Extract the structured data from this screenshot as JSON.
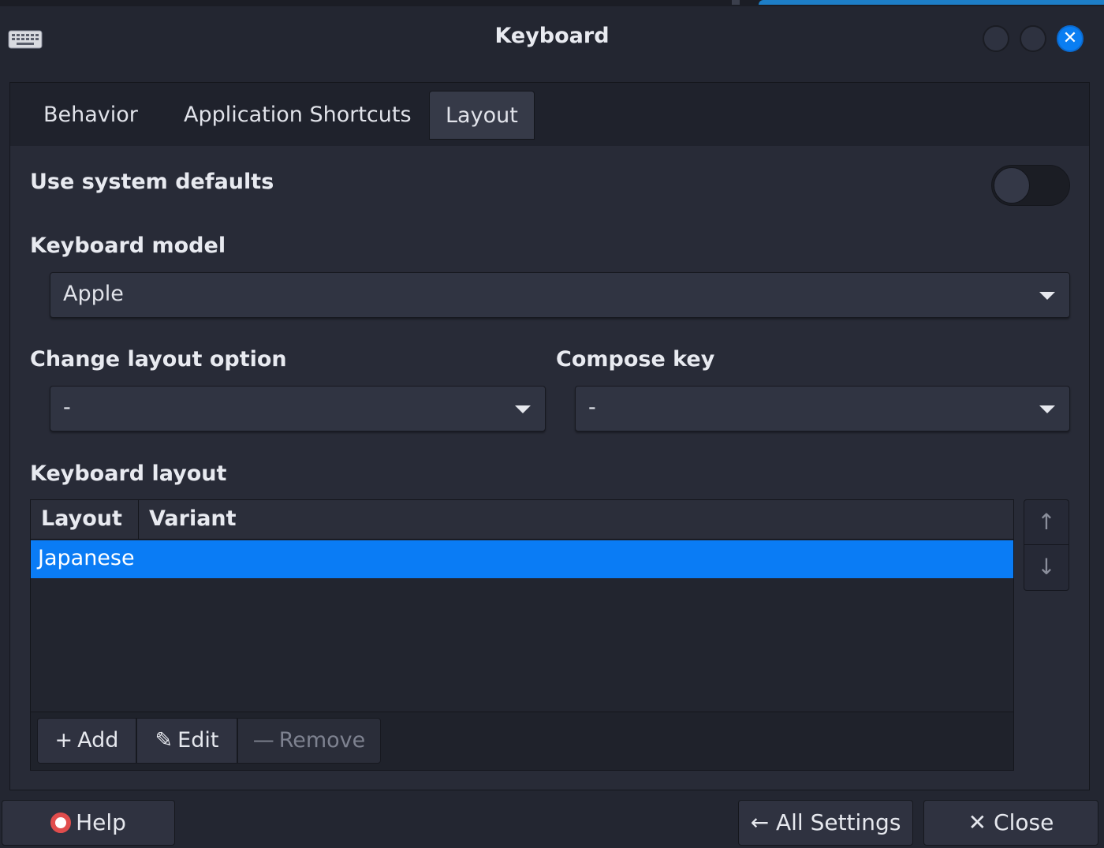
{
  "window": {
    "title": "Keyboard",
    "close_glyph": "✕"
  },
  "tabs": [
    {
      "label": "Behavior",
      "active": false
    },
    {
      "label": "Application Shortcuts",
      "active": false
    },
    {
      "label": "Layout",
      "active": true
    }
  ],
  "layout_page": {
    "use_system_defaults": {
      "label": "Use system defaults",
      "enabled": false
    },
    "keyboard_model": {
      "label": "Keyboard model",
      "value": "Apple"
    },
    "change_layout_option": {
      "label": "Change layout option",
      "value": "-"
    },
    "compose_key": {
      "label": "Compose key",
      "value": "-"
    },
    "keyboard_layout": {
      "label": "Keyboard layout",
      "columns": [
        "Layout",
        "Variant"
      ],
      "rows": [
        {
          "layout": "Japanese",
          "variant": "",
          "selected": true
        }
      ],
      "buttons": {
        "add": "Add",
        "edit": "Edit",
        "remove": "Remove"
      },
      "move_up_glyph": "↑",
      "move_down_glyph": "↓"
    }
  },
  "footer": {
    "help": "Help",
    "all_settings": "All Settings",
    "close": "Close"
  },
  "icons": {
    "add": "+",
    "edit": "✎",
    "remove": "—",
    "back_arrow": "←",
    "close_x": "✕"
  },
  "colors": {
    "accent": "#0a7cf5",
    "background": "#282b37"
  }
}
